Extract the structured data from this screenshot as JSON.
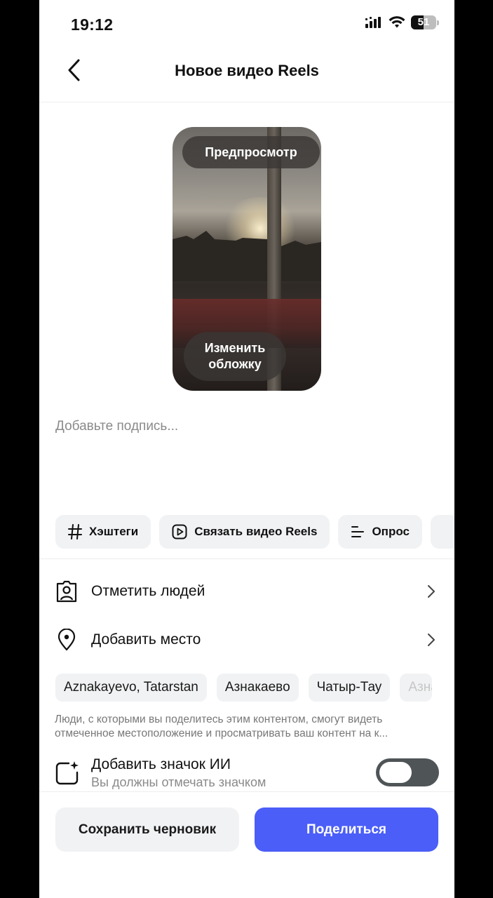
{
  "status_bar": {
    "time": "19:12",
    "battery": "51",
    "battery_level": 0.51
  },
  "header": {
    "title": "Новое видео Reels"
  },
  "preview": {
    "preview_label": "Предпросмотр",
    "cover_label_line1": "Изменить",
    "cover_label_line2": "обложку"
  },
  "caption": {
    "placeholder": "Добавьте подпись..."
  },
  "chips": [
    {
      "label": "Хэштеги",
      "icon": "hash-icon"
    },
    {
      "label": "Связать видео Reels",
      "icon": "reels-link-icon"
    },
    {
      "label": "Опрос",
      "icon": "poll-icon"
    }
  ],
  "rows": {
    "tag_people": "Отметить людей",
    "add_place": "Добавить место"
  },
  "places": [
    "Aznakayevo, Tatarstan",
    "Азнакаево",
    "Чатыр-Тау",
    "Азнакаевский"
  ],
  "location_note": {
    "line1": "Люди, с которыми вы поделитесь этим контентом, смогут видеть",
    "line2": "отмеченное местоположение и просматривать ваш контент на к..."
  },
  "ai_label": {
    "title": "Добавить значок ИИ",
    "subtitle": "Вы должны отмечать значком",
    "enabled": false
  },
  "actions": {
    "save_draft": "Сохранить черновик",
    "share": "Поделиться"
  },
  "colors": {
    "accent": "#4b5ef8",
    "chip_bg": "#f1f2f4",
    "toggle_off": "#4f5457"
  }
}
